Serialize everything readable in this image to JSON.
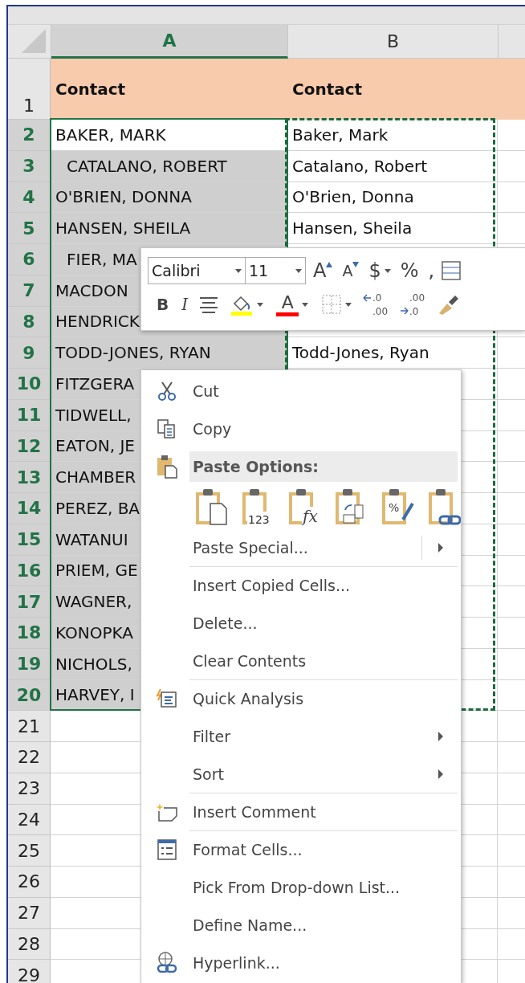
{
  "columns": [
    {
      "label": "A",
      "selected": true
    },
    {
      "label": "B",
      "selected": false
    }
  ],
  "header_row": {
    "number": "1",
    "cells": [
      "Contact",
      "Contact"
    ]
  },
  "rows": [
    {
      "number": "2",
      "selected": true,
      "active": true,
      "a": "BAKER, MARK",
      "b": "Baker, Mark"
    },
    {
      "number": "3",
      "selected": true,
      "active": false,
      "indented": true,
      "a": "CATALANO, ROBERT",
      "b": "Catalano, Robert"
    },
    {
      "number": "4",
      "selected": true,
      "active": false,
      "a": "O'BRIEN, DONNA",
      "b": "O'Brien, Donna"
    },
    {
      "number": "5",
      "selected": true,
      "active": false,
      "a": "HANSEN, SHEILA",
      "b": "Hansen, Sheila"
    },
    {
      "number": "6",
      "selected": true,
      "active": false,
      "indented": true,
      "a": "FIER, MA"
    },
    {
      "number": "7",
      "selected": true,
      "active": false,
      "a": "MACDON"
    },
    {
      "number": "8",
      "selected": true,
      "active": false,
      "a": "HENDRICK"
    },
    {
      "number": "9",
      "selected": true,
      "active": false,
      "a": "TODD-JONES, RYAN",
      "b": "Todd-Jones, Ryan"
    },
    {
      "number": "10",
      "selected": true,
      "active": false,
      "a": "FITZGERA"
    },
    {
      "number": "11",
      "selected": true,
      "active": false,
      "a": "TIDWELL,"
    },
    {
      "number": "12",
      "selected": true,
      "active": false,
      "a": "EATON, JE"
    },
    {
      "number": "13",
      "selected": true,
      "active": false,
      "a": "CHAMBER"
    },
    {
      "number": "14",
      "selected": true,
      "active": false,
      "a": "PEREZ, BA"
    },
    {
      "number": "15",
      "selected": true,
      "active": false,
      "a": "WATANUI"
    },
    {
      "number": "16",
      "selected": true,
      "active": false,
      "a": "PRIEM, GE"
    },
    {
      "number": "17",
      "selected": true,
      "active": false,
      "a": "WAGNER,"
    },
    {
      "number": "18",
      "selected": true,
      "active": false,
      "a": "KONOPKA"
    },
    {
      "number": "19",
      "selected": true,
      "active": false,
      "a": "NICHOLS,"
    },
    {
      "number": "20",
      "selected": true,
      "active": false,
      "a": "HARVEY, I"
    },
    {
      "number": "21",
      "selected": false
    },
    {
      "number": "22",
      "selected": false
    },
    {
      "number": "23",
      "selected": false
    },
    {
      "number": "24",
      "selected": false
    },
    {
      "number": "25",
      "selected": false
    },
    {
      "number": "26",
      "selected": false
    },
    {
      "number": "27",
      "selected": false
    },
    {
      "number": "28",
      "selected": false
    },
    {
      "number": "29",
      "selected": false
    }
  ],
  "mini_toolbar": {
    "font": "Calibri",
    "size": "11",
    "row1": [
      {
        "kind": "grow",
        "label": "A"
      },
      {
        "kind": "shrink",
        "label": "A"
      },
      {
        "kind": "currency",
        "label": "$",
        "dropdown": true
      },
      {
        "kind": "percent",
        "label": "%"
      },
      {
        "kind": "comma",
        "label": ","
      },
      {
        "kind": "table"
      }
    ],
    "row2": [
      {
        "kind": "bold",
        "label": "B"
      },
      {
        "kind": "italic",
        "label": "I"
      },
      {
        "kind": "center"
      },
      {
        "kind": "fill",
        "color": "#ffff00",
        "dropdown": true
      },
      {
        "kind": "fontcolor",
        "label": "A",
        "color": "#ff0000",
        "dropdown": true
      },
      {
        "kind": "borders",
        "dropdown": true
      },
      {
        "kind": "incdec",
        "top": ".0",
        "bottom": ".00"
      },
      {
        "kind": "decdec",
        "top": ".00",
        "bottom": ".0"
      },
      {
        "kind": "painter"
      }
    ]
  },
  "context_menu": [
    {
      "kind": "cut",
      "label": "Cut"
    },
    {
      "kind": "copy",
      "label": "Copy"
    },
    {
      "kind": "paste_header",
      "label": "Paste Options:"
    },
    {
      "kind": "paste_row",
      "options": [
        {
          "kind": "paste"
        },
        {
          "kind": "values",
          "mark": "123"
        },
        {
          "kind": "formulas",
          "mark": "fx"
        },
        {
          "kind": "transpose"
        },
        {
          "kind": "formatting",
          "mark": "%"
        },
        {
          "kind": "link"
        }
      ]
    },
    {
      "kind": "plain",
      "label": "Paste Special...",
      "submenu": true,
      "split": true
    },
    {
      "kind": "plain",
      "label": "Insert Copied Cells...",
      "divider_before": true
    },
    {
      "kind": "plain",
      "label": "Delete..."
    },
    {
      "kind": "plain",
      "label": "Clear Contents"
    },
    {
      "kind": "analysis",
      "label": "Quick Analysis",
      "divider_before": true
    },
    {
      "kind": "plain",
      "label": "Filter",
      "submenu": true
    },
    {
      "kind": "plain",
      "label": "Sort",
      "submenu": true
    },
    {
      "kind": "comment",
      "label": "Insert Comment",
      "divider_before": true
    },
    {
      "kind": "format",
      "label": "Format Cells...",
      "divider_before": true
    },
    {
      "kind": "plain",
      "label": "Pick From Drop-down List..."
    },
    {
      "kind": "plain",
      "label": "Define Name..."
    },
    {
      "kind": "hyperlink",
      "label": "Hyperlink..."
    }
  ]
}
